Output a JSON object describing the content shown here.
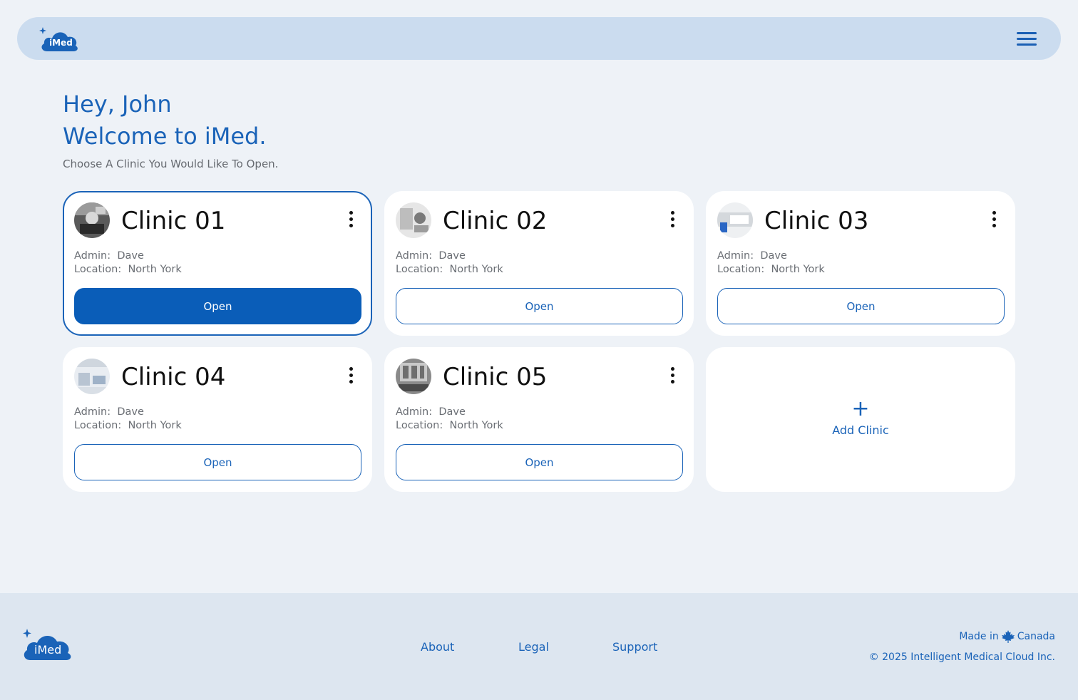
{
  "header": {
    "logo_text": "iMed",
    "menu_icon": "hamburger-menu-icon"
  },
  "greeting": {
    "line1": "Hey, John",
    "line2": "Welcome to iMed.",
    "subtitle": "Choose A Clinic You Would Like To Open."
  },
  "clinics": [
    {
      "name": "Clinic 01",
      "admin_label": "Admin:",
      "admin": "Dave",
      "location_label": "Location:",
      "location": "North York",
      "button": "Open",
      "selected": true
    },
    {
      "name": "Clinic 02",
      "admin_label": "Admin:",
      "admin": "Dave",
      "location_label": "Location:",
      "location": "North York",
      "button": "Open",
      "selected": false
    },
    {
      "name": "Clinic 03",
      "admin_label": "Admin:",
      "admin": "Dave",
      "location_label": "Location:",
      "location": "North York",
      "button": "Open",
      "selected": false
    },
    {
      "name": "Clinic 04",
      "admin_label": "Admin:",
      "admin": "Dave",
      "location_label": "Location:",
      "location": "North York",
      "button": "Open",
      "selected": false
    },
    {
      "name": "Clinic 05",
      "admin_label": "Admin:",
      "admin": "Dave",
      "location_label": "Location:",
      "location": "North York",
      "button": "Open",
      "selected": false
    }
  ],
  "add_clinic": {
    "icon": "plus-icon",
    "label": "Add Clinic"
  },
  "footer": {
    "logo_text": "iMed",
    "links": [
      "About",
      "Legal",
      "Support"
    ],
    "made_in_prefix": "Made in",
    "made_in_country": "Canada",
    "made_in_icon": "maple-leaf-icon",
    "copyright": "© 2025 Intelligent Medical Cloud Inc."
  },
  "colors": {
    "primary": "#0a5db8",
    "accent_text": "#1a63b8",
    "header_bg": "#cbdcef",
    "page_bg": "#eef2f7",
    "footer_bg": "#dde6f0"
  }
}
